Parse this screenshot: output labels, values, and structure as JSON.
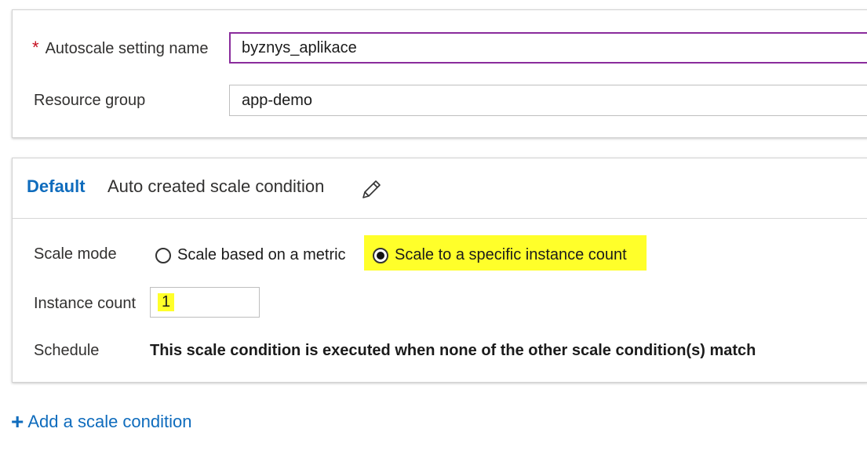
{
  "settings": {
    "name_label": "Autoscale setting name",
    "required_marker": "*",
    "name_value": "byznys_aplikace",
    "resource_group_label": "Resource group",
    "resource_group_value": "app-demo"
  },
  "condition": {
    "default_label": "Default",
    "name": "Auto created scale condition",
    "edit_icon": "pencil-icon",
    "scale_mode_label": "Scale mode",
    "scale_modes": [
      {
        "label": "Scale based on a metric",
        "selected": false
      },
      {
        "label": "Scale to a specific instance count",
        "selected": true
      }
    ],
    "instance_count_label": "Instance count",
    "instance_count_value": "1",
    "schedule_label": "Schedule",
    "schedule_text": "This scale condition is executed when none of the other scale condition(s) match"
  },
  "actions": {
    "add_condition_label": "Add a scale condition",
    "add_icon": "plus-icon"
  },
  "colors": {
    "accent": "#0f6cbd",
    "highlight": "#ffff2a",
    "required": "#c50f1f",
    "focus_border": "#8a2c9c"
  }
}
